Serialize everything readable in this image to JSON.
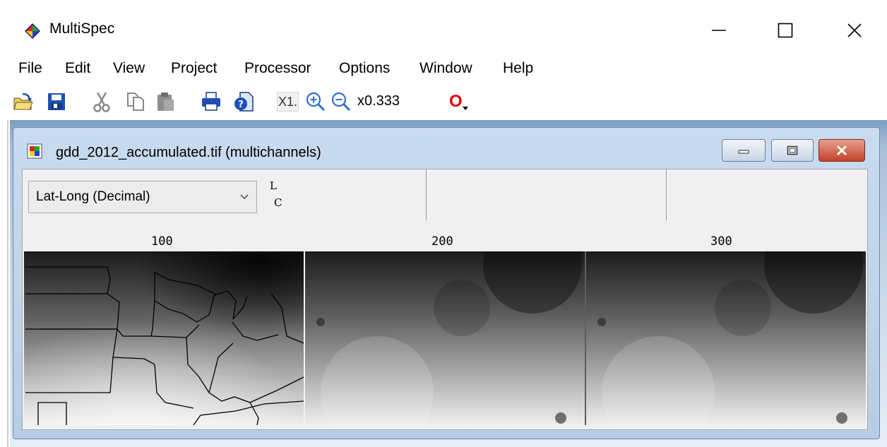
{
  "window": {
    "title": "MultiSpec",
    "minimize_symbol": "—",
    "maximize_symbol": "☐",
    "close_symbol": "✕"
  },
  "menu": [
    {
      "label": "File"
    },
    {
      "label": "Edit"
    },
    {
      "label": "View"
    },
    {
      "label": "Project"
    },
    {
      "label": "Processor"
    },
    {
      "label": "Options"
    },
    {
      "label": "Window"
    },
    {
      "label": "Help"
    }
  ],
  "toolbar": {
    "zoom_reset_label": "X1.",
    "zoom_level": "x0.333",
    "overlay_label": "O"
  },
  "image_window": {
    "title": "gdd_2012_accumulated.tif (multichannels)",
    "coordinate_units": "Lat-Long (Decimal)",
    "line_label": "L",
    "column_label": "C",
    "column_ticks": [
      "100",
      "200",
      "300"
    ]
  }
}
